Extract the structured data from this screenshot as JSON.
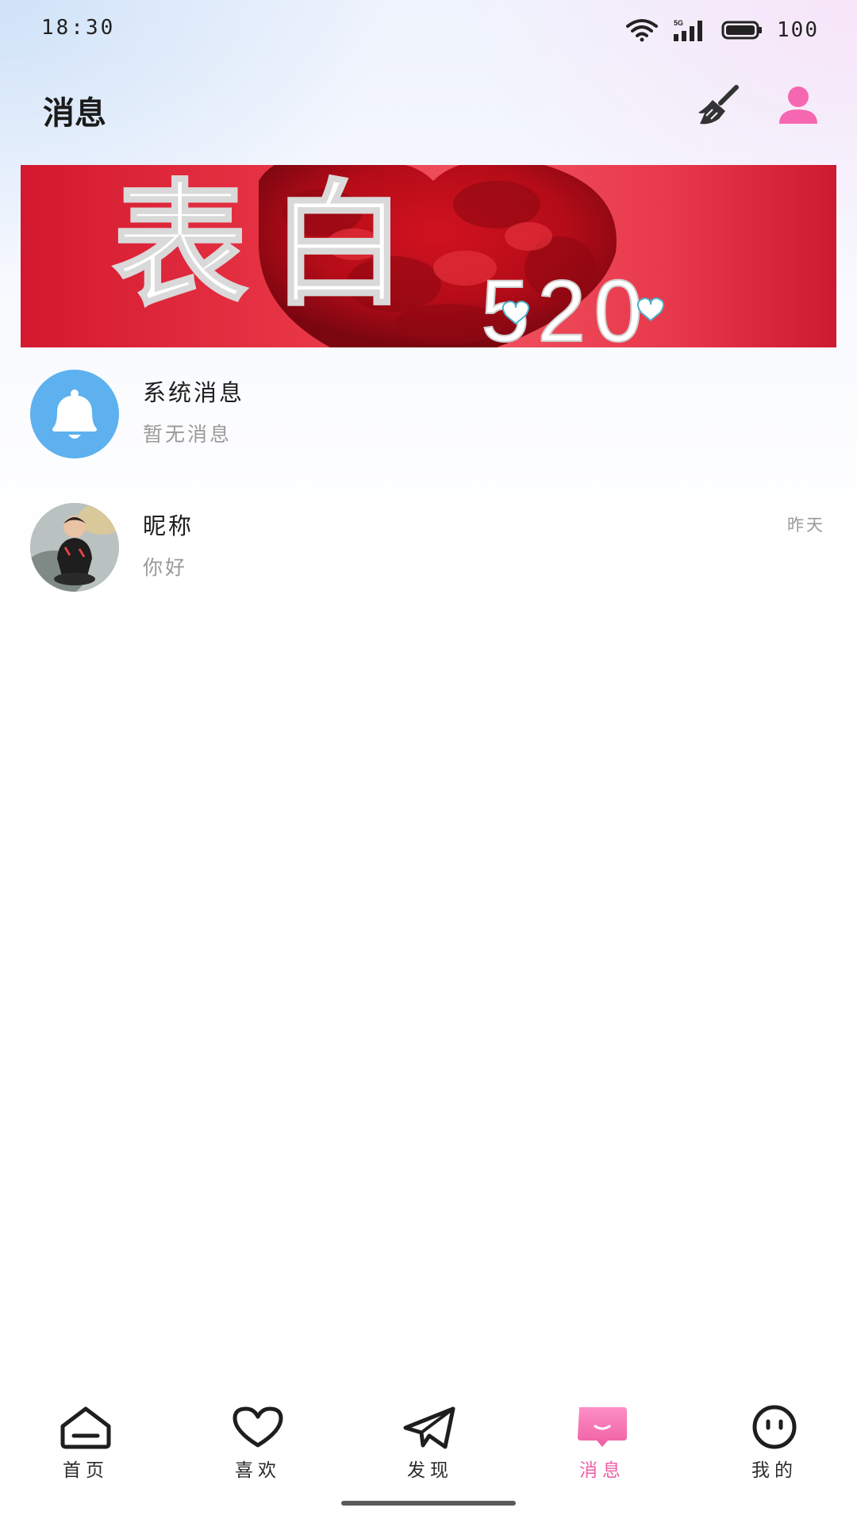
{
  "status_bar": {
    "time": "18:30",
    "battery": "100",
    "network": "5G"
  },
  "header": {
    "title": "消息",
    "clean_icon": "broom-icon",
    "profile_icon": "person-icon"
  },
  "banner": {
    "big_text": "表白",
    "number_text": "520"
  },
  "messages": [
    {
      "icon": "bell-icon",
      "title": "系统消息",
      "preview": "暂无消息",
      "time": ""
    },
    {
      "icon": "user-photo",
      "title": "昵称",
      "preview": "你好",
      "time": "昨天"
    }
  ],
  "tabs": [
    {
      "label": "首页",
      "icon": "home-icon",
      "active": false
    },
    {
      "label": "喜欢",
      "icon": "heart-icon",
      "active": false
    },
    {
      "label": "发现",
      "icon": "paper-plane-icon",
      "active": false
    },
    {
      "label": "消息",
      "icon": "message-icon",
      "active": true
    },
    {
      "label": "我的",
      "icon": "face-icon",
      "active": false
    }
  ],
  "colors": {
    "accent": "#ef5fa3",
    "bell_bg": "#5db1ee",
    "banner_red": "#e02a3c"
  }
}
